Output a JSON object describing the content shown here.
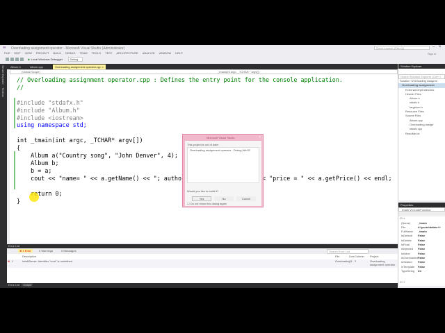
{
  "window": {
    "title": "Overloading assignment operator - Microsoft Visual Studio (Administrator)",
    "quick_launch": "Quick Launch (Ctrl+Q)",
    "sign_in": "Sign in"
  },
  "menu": [
    "FILE",
    "EDIT",
    "VIEW",
    "PROJECT",
    "BUILD",
    "DEBUG",
    "TEAM",
    "TOOLS",
    "TEST",
    "ARCHITECTURE",
    "ANALYZE",
    "WINDOW",
    "HELP"
  ],
  "toolbar": {
    "debugger": "Local Windows Debugger",
    "config": "Debug"
  },
  "left_tabs": [
    "Server Explorer",
    "Toolbox"
  ],
  "tabs": [
    {
      "label": "Album.h"
    },
    {
      "label": "Album.cpp"
    },
    {
      "label": "Overloading assignment operator.cpp"
    }
  ],
  "scope": {
    "left": "(Global Scope)",
    "right": "_tmain(int argc, _TCHAR * argv[])"
  },
  "code": [
    "// Overloading assignment operator.cpp : Defines the entry point for the console application.",
    "//",
    "",
    "#include \"stdafx.h\"",
    "#include \"Album.h\"",
    "#include <iostream>",
    "using namespace std;",
    "",
    "int _tmain(int argc, _TCHAR* argv[])",
    "{",
    "    Album a(\"Country song\", \"John Denver\", 4);",
    "    Album b;",
    "    b = a;",
    "    cout << \"name= \" << a.getName() << \"; author= \" << a.getAuthor() << \"price = \" << a.getPrice() << endl;",
    "",
    "    return 0;",
    "}"
  ],
  "dialog": {
    "title": "Microsoft Visual Studio",
    "message": "This project is out of date:",
    "project": "Overloading assignment operator - Debug Win32",
    "question": "Would you like to build it?",
    "yes": "Yes",
    "no": "No",
    "cancel": "Cancel",
    "checkbox": "Do not show this dialog again"
  },
  "error_list": {
    "title": "Error List",
    "errors": "1 Error",
    "warnings": "0 Warnings",
    "messages": "0 Messages",
    "search": "Search Error List",
    "columns": [
      "Description",
      "File",
      "Line",
      "Column",
      "Project"
    ],
    "rows": [
      {
        "num": "1",
        "description": "IntelliSense: identifier \"cout\" is undefined",
        "file": "Overloading",
        "line": "13",
        "column": "2",
        "project": "Overloading assignment operator"
      }
    ]
  },
  "bottom_tabs": [
    "Error List",
    "Output"
  ],
  "solution_explorer": {
    "title": "Solution Explorer",
    "search": "Search Solution Explorer (Ctrl+;)",
    "items": [
      "Solution 'Overloading assignm",
      "Overloading assignment",
      "External Dependencies",
      "Header Files",
      "Album.h",
      "stdafx.h",
      "targetver.h",
      "Resource Files",
      "Source Files",
      "Album.cpp",
      "Overloading assign",
      "stdafx.cpp",
      "ReadMe.txt"
    ]
  },
  "properties": {
    "title": "Properties",
    "object": "_tmain VCCodeFunction",
    "section": "C++",
    "rows": [
      [
        "(Name)",
        "_tmain"
      ],
      [
        "File",
        "d:\\yocto\\data\\c++"
      ],
      [
        "FullName",
        "_tmain"
      ],
      [
        "IsDefault",
        "False"
      ],
      [
        "IsDelete",
        "False"
      ],
      [
        "IsFinal",
        "False"
      ],
      [
        "IsInjected",
        "False"
      ],
      [
        "IsInline",
        "False"
      ],
      [
        "IsOverloaded",
        "False"
      ],
      [
        "IsSealed",
        "False"
      ],
      [
        "IsTemplate",
        "False"
      ],
      [
        "TypeString",
        "int"
      ]
    ],
    "footer": "C++"
  }
}
